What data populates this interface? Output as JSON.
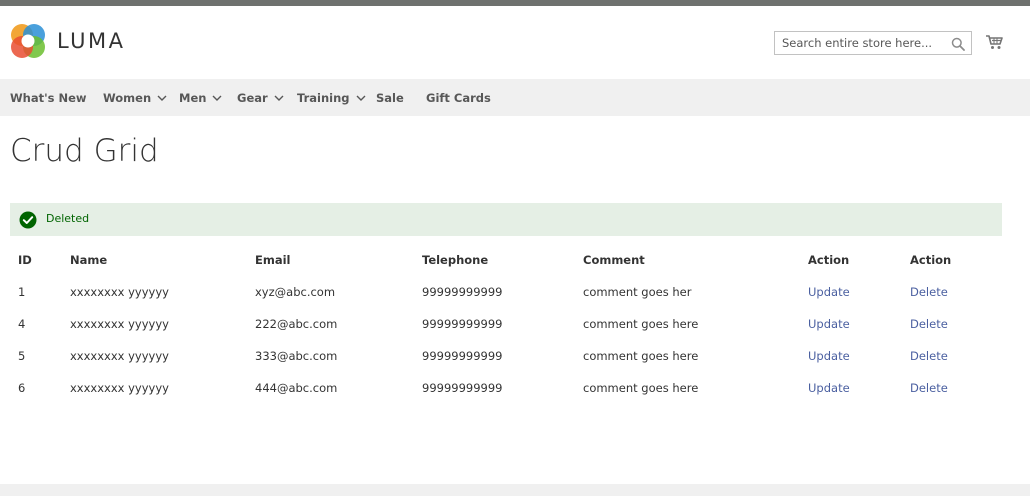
{
  "header": {
    "logo_text": "LUMA",
    "search": {
      "placeholder": "Search entire store here..."
    },
    "icons": {
      "search": "search-icon",
      "cart": "cart-icon",
      "logo": "luma-logo-icon"
    }
  },
  "nav": {
    "items": [
      {
        "label": "What's New",
        "has_dropdown": false
      },
      {
        "label": "Women",
        "has_dropdown": true
      },
      {
        "label": "Men",
        "has_dropdown": true
      },
      {
        "label": "Gear",
        "has_dropdown": true
      },
      {
        "label": "Training",
        "has_dropdown": true
      },
      {
        "label": "Sale",
        "has_dropdown": false
      },
      {
        "label": "Gift Cards",
        "has_dropdown": false
      }
    ]
  },
  "page": {
    "title": "Crud Grid"
  },
  "message": {
    "text": "Deleted",
    "type": "success"
  },
  "grid": {
    "columns": [
      "ID",
      "Name",
      "Email",
      "Telephone",
      "Comment",
      "Action",
      "Action"
    ],
    "rows": [
      {
        "id": "1",
        "name": "xxxxxxxx yyyyyy",
        "email": "xyz@abc.com",
        "telephone": "99999999999",
        "comment": "comment goes her",
        "update": "Update",
        "delete": "Delete"
      },
      {
        "id": "4",
        "name": "xxxxxxxx yyyyyy",
        "email": "222@abc.com",
        "telephone": "99999999999",
        "comment": "comment goes here",
        "update": "Update",
        "delete": "Delete"
      },
      {
        "id": "5",
        "name": "xxxxxxxx yyyyyy",
        "email": "333@abc.com",
        "telephone": "99999999999",
        "comment": "comment goes here",
        "update": "Update",
        "delete": "Delete"
      },
      {
        "id": "6",
        "name": "xxxxxxxx yyyyyy",
        "email": "444@abc.com",
        "telephone": "99999999999",
        "comment": "comment goes here",
        "update": "Update",
        "delete": "Delete"
      }
    ]
  },
  "colors": {
    "top_bar": "#6e716e",
    "nav_background": "#f0f0f0",
    "success_background": "#e5efe5",
    "success_text": "#006400",
    "link": "#4a5fa0"
  }
}
